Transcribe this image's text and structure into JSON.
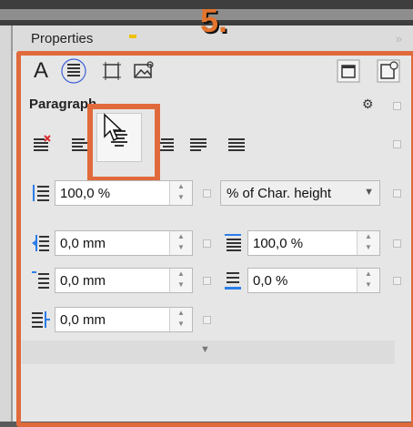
{
  "panel": {
    "title": "Properties",
    "step_label": "5.",
    "collapse_glyph": "»"
  },
  "tabs": [
    {
      "name": "character-tab",
      "icon": "A"
    },
    {
      "name": "paragraph-tab",
      "icon": "paragraph-icon"
    },
    {
      "name": "frame-tab",
      "icon": "frame-icon"
    },
    {
      "name": "image-tab",
      "icon": "image-icon"
    }
  ],
  "section": {
    "title": "Paragraph",
    "settings_icon": "⚙"
  },
  "alignment": [
    "no-align",
    "align-left",
    "align-center",
    "align-right",
    "justify-left",
    "justify-full"
  ],
  "fields": {
    "line_spacing": {
      "value": "100,0 %"
    },
    "line_spacing_unit": {
      "value": "% of Char. height"
    },
    "indent_left": {
      "value": "0,0 mm"
    },
    "char_spacing": {
      "value": "100,0 %"
    },
    "space_before": {
      "value": "0,0 mm"
    },
    "word_spacing": {
      "value": "0,0 %"
    },
    "space_after": {
      "value": "0,0 mm"
    }
  },
  "colors": {
    "highlight": "#e06a3c",
    "accent_blue": "#2b7de9"
  }
}
